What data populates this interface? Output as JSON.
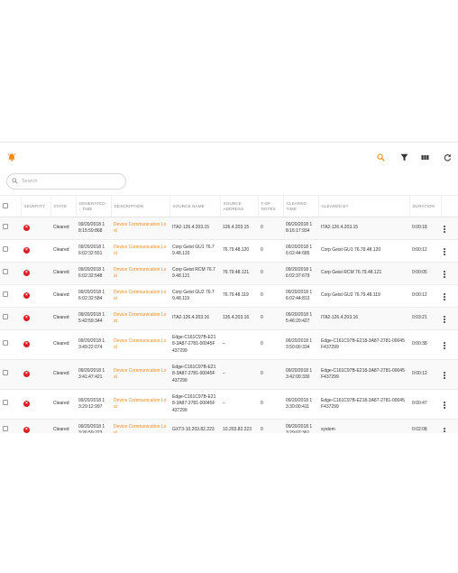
{
  "toolbar": {
    "app_icon": "alarm-bell-icon",
    "search_icon": "search-icon",
    "filter_icon": "filter-icon",
    "columns_icon": "columns-icon",
    "refresh_icon": "refresh-icon",
    "accent_color": "#ef8a1b"
  },
  "search": {
    "placeholder": "Search"
  },
  "table": {
    "headers": {
      "severity": "SEVERITY",
      "state": "STATE",
      "generated_time": "GENERATED ↓ TIME",
      "description": "DESCRIPTION",
      "source_name": "SOURCE NAME",
      "source_address": "SOURCE ADDRESS",
      "notes": "# OF NOTES",
      "cleared_time": "CLEARED TIME",
      "cleared_by": "CLEARED BY",
      "duration": "DURATION"
    },
    "rows": [
      {
        "state": "Cleared",
        "generated": "09/20/2018 18:15:59:868",
        "description": "Device Communication Lost",
        "source_name": "ITA2-126.4.203.15",
        "source_address": "126.4.203.15",
        "notes": "0",
        "cleared_time": "09/20/2018 18:16:17:934",
        "cleared_by": "ITA2-126.4.203.15",
        "duration": "0:00:18"
      },
      {
        "state": "Cleared",
        "generated": "09/20/2018 16:02:32:551",
        "description": "Device Communication Lost",
        "source_name": "Corp Geist GU1 76.79.48.120",
        "source_address": "76.79.48.120",
        "notes": "0",
        "cleared_time": "09/20/2018 16:02:44:685",
        "cleared_by": "Corp Geist GU1 76.79.48.120",
        "duration": "0:00:12"
      },
      {
        "state": "Cleared",
        "generated": "09/20/2018 16:02:32:548",
        "description": "Device Communication Lost",
        "source_name": "Corp Geist RCM 76.79.48.121",
        "source_address": "76.79.48.121",
        "notes": "0",
        "cleared_time": "09/20/2018 16:02:37:679",
        "cleared_by": "Corp Geist RCM 76.79.48.121",
        "duration": "0:00:05"
      },
      {
        "state": "Cleared",
        "generated": "09/20/2018 16:02:32:584",
        "description": "Device Communication Lost",
        "source_name": "Corp Geist GU2 76.79.48.119",
        "source_address": "76.79.48.119",
        "notes": "0",
        "cleared_time": "09/20/2018 16:02:44:813",
        "cleared_by": "Corp Geist GU2 76.79.48.119",
        "duration": "0:00:12"
      },
      {
        "state": "Cleared",
        "generated": "09/20/2018 15:42:59:344",
        "description": "Device Communication Lost",
        "source_name": "ITA2-126.4.203.16",
        "source_address": "126.4.203.16",
        "notes": "0",
        "cleared_time": "09/20/2018 15:46:20:427",
        "cleared_by": "ITA2-126.4.203.16",
        "duration": "0:03:21"
      },
      {
        "state": "Cleared",
        "generated": "09/20/2018 13:49:22:074",
        "description": "Device Communication Lost",
        "source_name": "Edge-C161C97B-E218-3A87-2781-00045F437299",
        "source_address": "–",
        "notes": "0",
        "cleared_time": "09/20/2018 13:50:00:334",
        "cleared_by": "Edge-C161C97B-E218-3A87-2781-00045F437299",
        "duration": "0:00:38"
      },
      {
        "state": "Cleared",
        "generated": "09/20/2018 13:41:47:421",
        "description": "Device Communication Lost",
        "source_name": "Edge-C161C97B-E218-3A87-2781-00045F437299",
        "source_address": "–",
        "notes": "0",
        "cleared_time": "09/20/2018 13:42:00:330",
        "cleared_by": "Edge-C161C97B-E218-3A87-2781-00045F437299",
        "duration": "0:00:12"
      },
      {
        "state": "Cleared",
        "generated": "09/20/2018 13:29:12:997",
        "description": "Device Communication Lost",
        "source_name": "Edge-C161C97B-E218-3A87-2781-00045F437299",
        "source_address": "–",
        "notes": "0",
        "cleared_time": "09/20/2018 13:30:00:411",
        "cleared_by": "Edge-C161C97B-E218-3A87-2781-00045F437299",
        "duration": "0:00:47"
      },
      {
        "state": "Cleared",
        "generated": "09/20/2018 13:26:59:223",
        "description": "Device Communication Lost",
        "source_name": "GXT3-10.203.82.223",
        "source_address": "10.203.82.223",
        "notes": "0",
        "cleared_time": "09/20/2018 13:29:07:361",
        "cleared_by": "system",
        "duration": "0:02:08"
      }
    ]
  }
}
